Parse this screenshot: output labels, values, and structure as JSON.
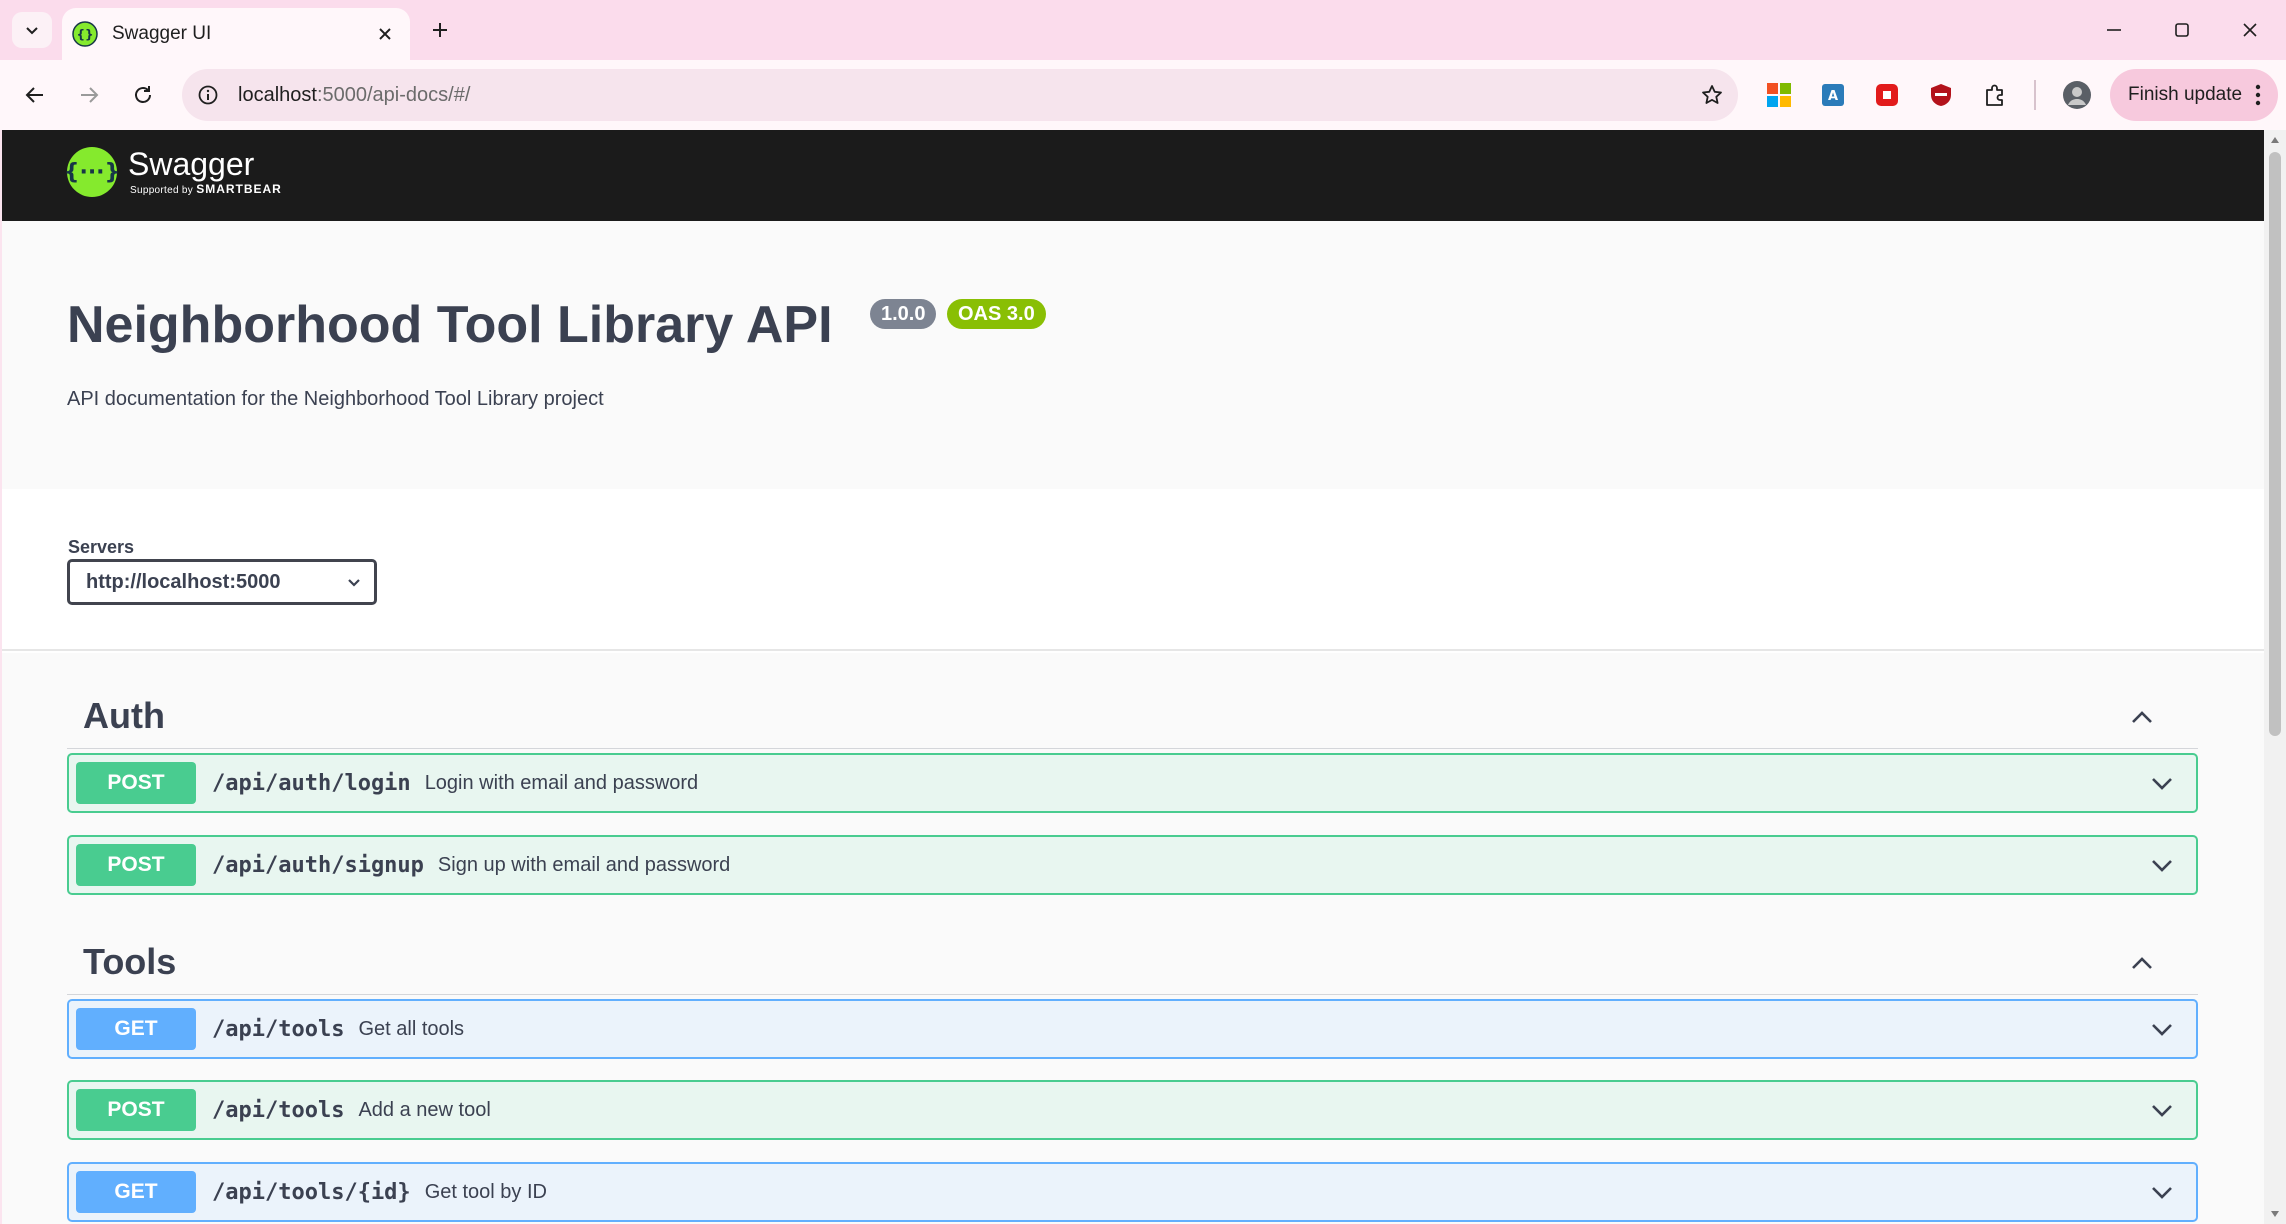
{
  "browser": {
    "tab_title": "Swagger UI",
    "url_host": "localhost",
    "url_rest": ":5000/api-docs/#/",
    "finish_update_label": "Finish update"
  },
  "swagger": {
    "logo_name": "Swagger",
    "logo_supported_by": "Supported by",
    "logo_company": "SMARTBEAR",
    "api_title": "Neighborhood Tool Library API",
    "version": "1.0.0",
    "oas": "OAS 3.0",
    "description": "API documentation for the Neighborhood Tool Library project",
    "servers_label": "Servers",
    "server_selected": "http://localhost:5000"
  },
  "tags": [
    {
      "name": "Auth",
      "operations": [
        {
          "method": "POST",
          "path": "/api/auth/login",
          "summary": "Login with email and password"
        },
        {
          "method": "POST",
          "path": "/api/auth/signup",
          "summary": "Sign up with email and password"
        }
      ]
    },
    {
      "name": "Tools",
      "operations": [
        {
          "method": "GET",
          "path": "/api/tools",
          "summary": "Get all tools"
        },
        {
          "method": "POST",
          "path": "/api/tools",
          "summary": "Add a new tool"
        },
        {
          "method": "GET",
          "path": "/api/tools/{id}",
          "summary": "Get tool by ID"
        }
      ]
    }
  ],
  "colors": {
    "post": "#49cc90",
    "get": "#61affe",
    "swagger_green": "#85ea2d",
    "header_bg": "#1b1b1b",
    "chrome_pink": "#fbdcec"
  }
}
